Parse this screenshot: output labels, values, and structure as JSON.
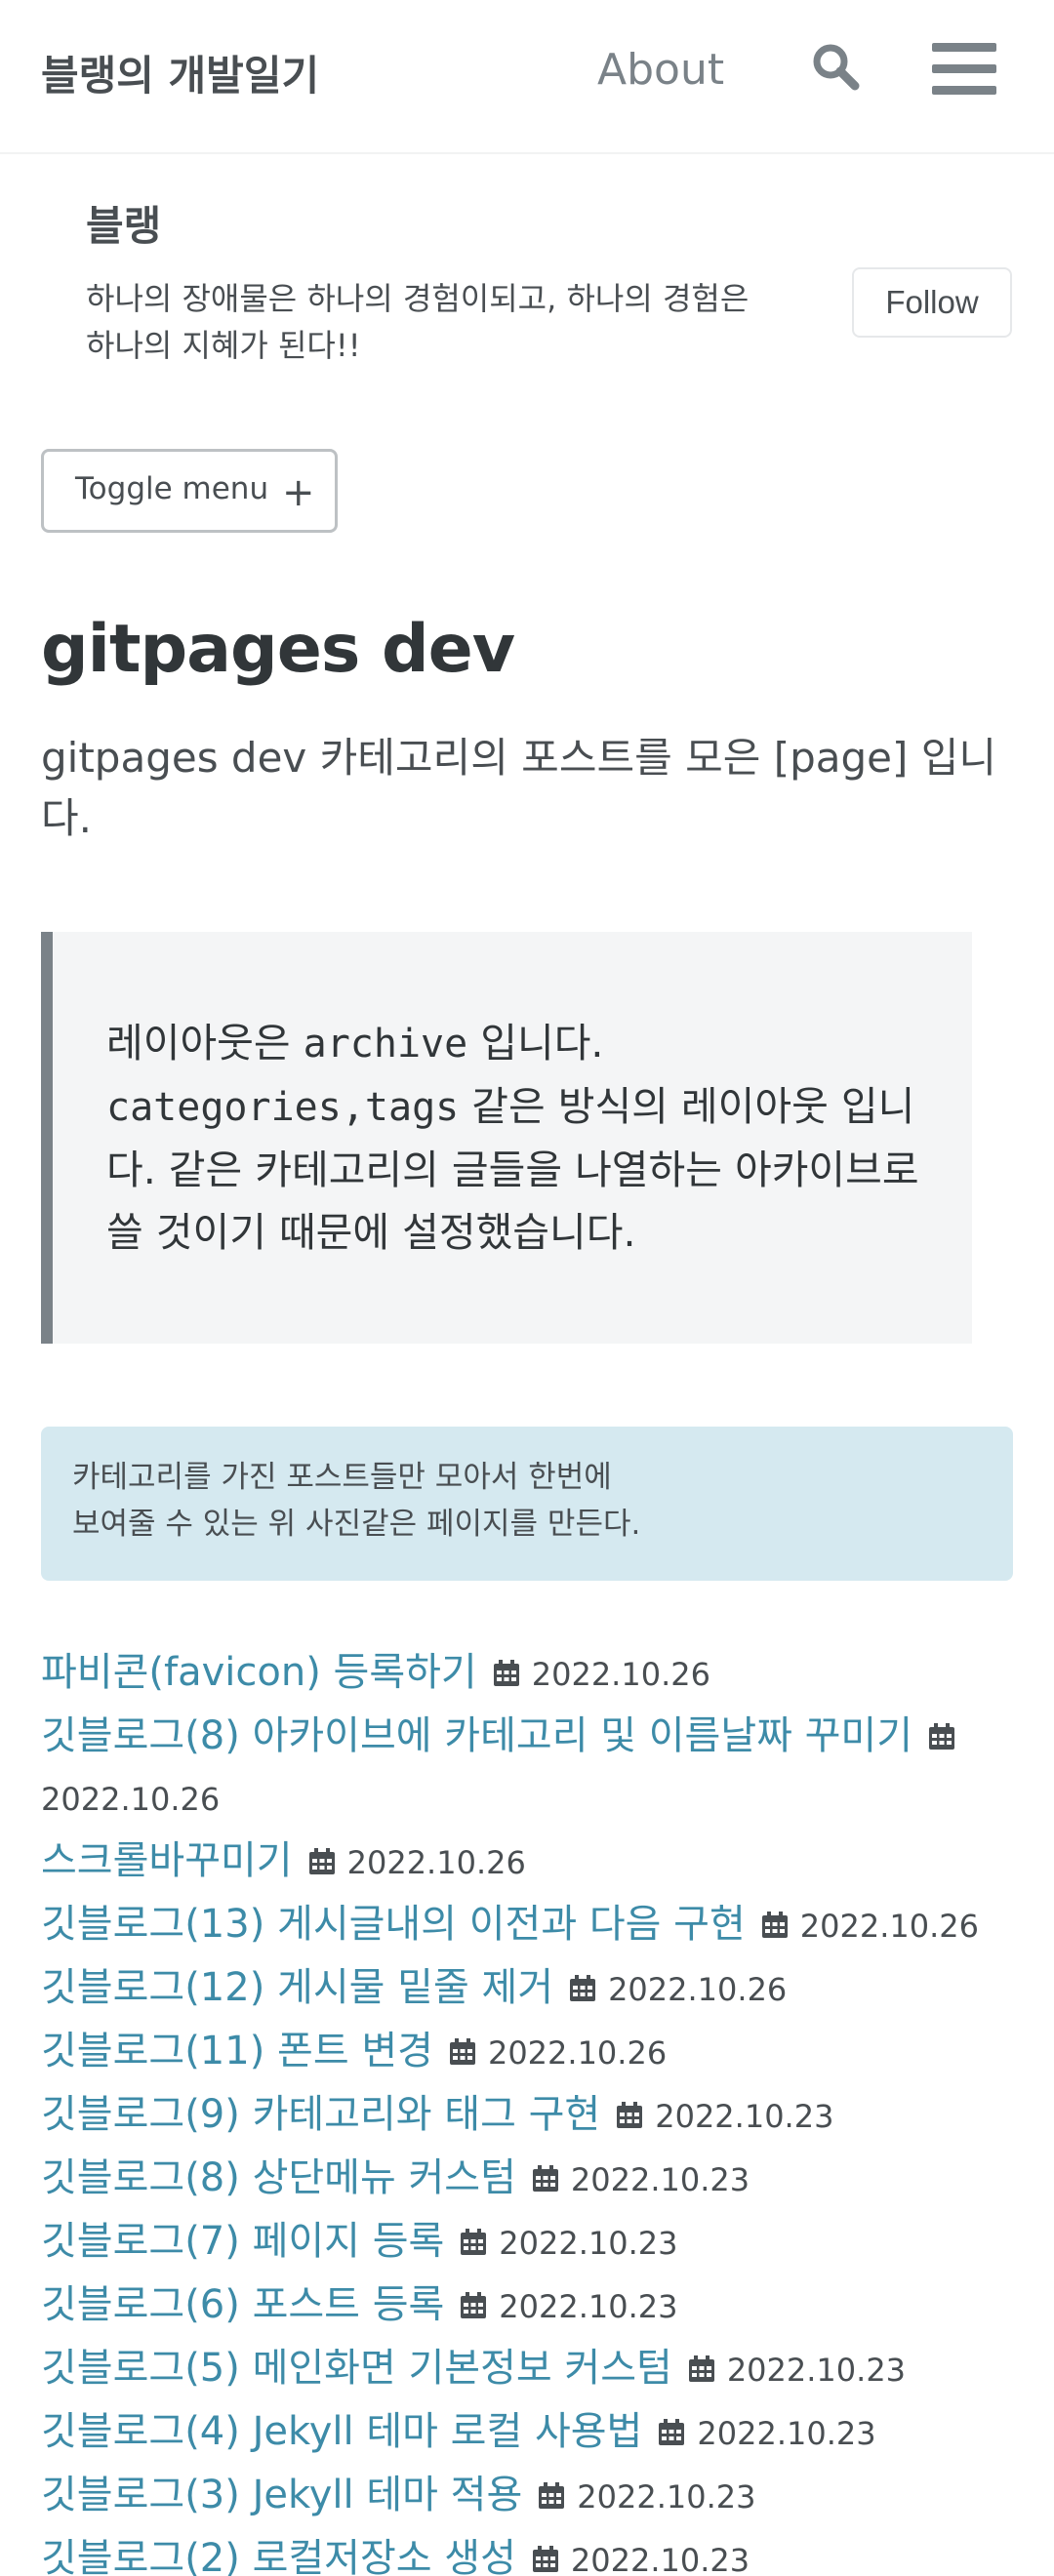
{
  "header": {
    "site_title": "블랭의 개발일기",
    "nav_about": "About",
    "search_icon": "search-icon",
    "menu_icon": "hamburger-icon"
  },
  "author": {
    "name": "블랭",
    "bio_line1": "하나의 장애물은 하나의 경험이되고, 하나의 경험은",
    "bio_line2": "하나의 지혜가 된다!!",
    "follow_label": "Follow"
  },
  "sidebar": {
    "toggle_label": "Toggle menu",
    "toggle_icon": "+"
  },
  "page": {
    "title": "gitpages dev",
    "lead": "gitpages dev 카테고리의 포스트를 모은 [page] 입니다."
  },
  "quote": {
    "line1_prefix": "레이아웃은 ",
    "line1_code": "archive",
    "line1_suffix": " 입니다.",
    "line2_code": "categories,tags",
    "line2_rest": " 같은 방식의 레이아웃 입니다.  같은 카테고리의 글들을 나열하는 아카이브로 쓸 것이기 때문에 설정했습니다."
  },
  "notice": {
    "line1": "카테고리를 가진 포스트들만 모아서 한번에",
    "line2": "보여줄 수 있는 위 사진같은 페이지를 만든다."
  },
  "posts": [
    {
      "title": "파비콘(favicon) 등록하기",
      "date": "2022.10.26"
    },
    {
      "title": "깃블로그(8) 아카이브에 카테고리 및 이름날짜 꾸미기",
      "date": "2022.10.26"
    },
    {
      "title": "스크롤바꾸미기",
      "date": "2022.10.26"
    },
    {
      "title": "깃블로그(13) 게시글내의 이전과 다음 구현",
      "date": "2022.10.26"
    },
    {
      "title": "깃블로그(12) 게시물 밑줄 제거",
      "date": "2022.10.26"
    },
    {
      "title": "깃블로그(11) 폰트 변경",
      "date": "2022.10.26"
    },
    {
      "title": "깃블로그(9) 카테고리와 태그 구현",
      "date": "2022.10.23"
    },
    {
      "title": "깃블로그(8) 상단메뉴 커스텀",
      "date": "2022.10.23"
    },
    {
      "title": "깃블로그(7) 페이지 등록",
      "date": "2022.10.23"
    },
    {
      "title": "깃블로그(6) 포스트 등록",
      "date": "2022.10.23"
    },
    {
      "title": "깃블로그(5) 메인화면 기본정보 커스텀",
      "date": "2022.10.23"
    },
    {
      "title": "깃블로그(4) Jekyll 테마 로컬 사용법",
      "date": "2022.10.23"
    },
    {
      "title": "깃블로그(3) Jekyll 테마 적용",
      "date": "2022.10.23"
    },
    {
      "title": "깃블로그(2) 로컬저장소 생성",
      "date": "2022.10.23"
    }
  ],
  "colors": {
    "link": "#3d8ba8",
    "notice_bg": "#d5e9f0",
    "quote_bg": "#f4f5f6",
    "quote_border": "#7a8288"
  }
}
